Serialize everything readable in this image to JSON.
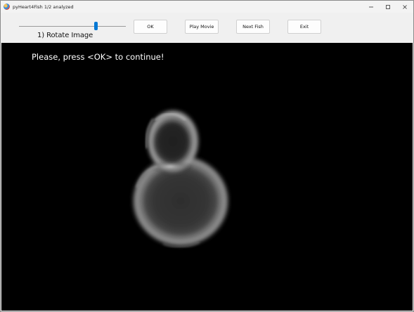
{
  "window": {
    "title": "pyHeart4Fish 1/2 analyzed",
    "caption_buttons": [
      "minimize-icon",
      "maximize-icon",
      "close-icon"
    ]
  },
  "toolbar": {
    "slider_label": "1) Rotate Image",
    "slider_value_fraction": 0.72,
    "ok_label": "OK",
    "play_movie_label": "Play Movie",
    "next_fish_label": "Next Fish",
    "exit_label": "Exit"
  },
  "canvas": {
    "instruction": "Please, press <OK> to continue!",
    "background": "#000000"
  },
  "colors": {
    "accent": "#0078d4",
    "window_bg": "#f0f0f0"
  }
}
